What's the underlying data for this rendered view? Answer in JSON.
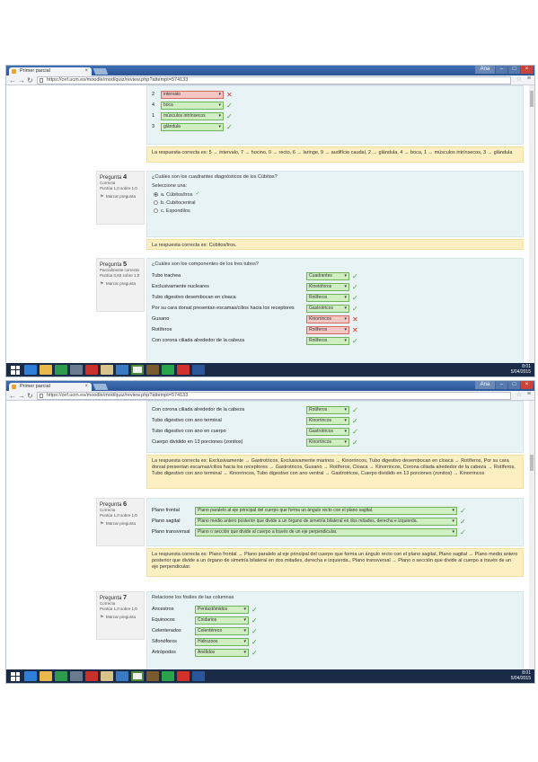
{
  "screens": [
    {
      "tab_title": "Primer parcial",
      "url": "https://cef.ucm.es/moodle/mod/quiz/review.php?attempt=574133",
      "window_user": "Ana",
      "q3_rows": [
        {
          "num": "2",
          "value": "intervalo",
          "state": "bad"
        },
        {
          "num": "4",
          "value": "boca",
          "state": "ok"
        },
        {
          "num": "1",
          "value": "músculos intrínsecos",
          "state": "ok"
        },
        {
          "num": "3",
          "value": "glándula",
          "state": "ok"
        }
      ],
      "q3_feedback": "La respuesta correcta es: 5 → intervalo, 7 → hocino, 0 → recto, 6 → laringe, 9 → audifício caudal, 2 → glándula, 4 → boca, 1 → músculos intrínsecos, 3 → glándula",
      "q4": {
        "number": "4",
        "status": "Correcta",
        "score": "Puntúa 1,0 sobre 1,0",
        "flag": "Marcar pregunta",
        "text": "¿Cuáles son los cuadrantes diagnósticos de los Cúbitos?",
        "prompt": "Seleccione una:",
        "options": [
          {
            "label": "a. Cúbitos/tros",
            "selected": true,
            "correct": true
          },
          {
            "label": "b. Cubitocentral",
            "selected": false
          },
          {
            "label": "c. Espondilos",
            "selected": false
          }
        ],
        "feedback": "La respuesta correcta es: Cúbitos/tros."
      },
      "q5": {
        "number": "5",
        "status": "Parcialmente correcta",
        "score": "Puntúa 0,60 sobre 1,0",
        "flag": "Marcar pregunta",
        "text": "¿Cuáles son los componentes de los tres tubos?",
        "rows": [
          {
            "label": "Tubo trachea",
            "value": "Cuadrantes",
            "state": "ok"
          },
          {
            "label": "Exclusivamente nucleares",
            "value": "Kinetóforos",
            "state": "ok"
          },
          {
            "label": "Tubo digestivo desembocan en cloaca",
            "value": "Rotíferos",
            "state": "ok"
          },
          {
            "label": "Por su cara dorsal presentan escamas/cilios hacia los receptores",
            "value": "Gastrotricos",
            "state": "ok"
          },
          {
            "label": "Gusano",
            "value": "Kinorrincos",
            "state": "bad"
          },
          {
            "label": "Rotíferos",
            "value": "Rotíferos",
            "state": "bad"
          },
          {
            "label": "Con corona ciliada alrededor de la cabeza",
            "value": "Rotíferos",
            "state": "ok"
          }
        ]
      }
    },
    {
      "tab_title": "Primer parcial",
      "url": "https://cef.ucm.es/moodle/mod/quiz/review.php?attempt=574133",
      "window_user": "Ana",
      "q5_rows_cont": [
        {
          "label": "Con corona ciliada alrededor de la cabeza",
          "value": "Rotíferos",
          "state": "ok"
        },
        {
          "label": "Tubo digestivo con ano terminal",
          "value": "Kinorrincos",
          "state": "ok"
        },
        {
          "label": "Tubo digestivo con ano en cuerpo",
          "value": "Gastrotricos",
          "state": "ok"
        },
        {
          "label": "Cuerpo dividido en 13 porciones (zonitos)",
          "value": "Kinorrincos",
          "state": "ok"
        }
      ],
      "q5_feedback": "La respuesta correcta es: Exclusivamente → Gastrotricos, Exclusivamente marinos → Kinorrincos, Tubo digestivo desembocan en cloaca → Rotíferos, Por su cara dorsal presentan escamas/cilios hacia los receptores → Gastrotricos, Gusano → Rotíferos, Cloaca → Kinorrincos, Corona ciliada alrededor de la cabeza → Rotíferos, Tubo digestivo con ano terminal → Kinorrincos, Tubo digestivo con ano ventral → Gastrotricos, Cuerpo dividido en 13 porciones (zonitos) → Kinorrincos",
      "q6": {
        "number": "6",
        "status": "Correcta",
        "score": "Puntúa 1,0 sobre 1,0",
        "flag": "Marcar pregunta",
        "rows": [
          {
            "label": "Plano frontal",
            "value": "Plano paralelo al eje principal del cuerpo que forma un ángulo recto con el plano sagital."
          },
          {
            "label": "Plano sagital",
            "value": "Plano medio antero posterior que divide a un órgano de simetría bilateral en dos mitades, derecha e izquierda."
          },
          {
            "label": "Plano transversal",
            "value": "Plano o sección que divide al cuerpo a través de un eje perpendicular."
          }
        ],
        "feedback": "La respuesta correcta es: Plano frontal → Plano paralelo al eje principal del cuerpo que forma un ángulo recto con el plano sagital, Plano sagital → Plano medio antero posterior que divide a un órgano de simetría bilateral en dos mitades, derecha e izquierda., Plano transversal → Plano o sección que divide al cuerpo a través de un eje perpendicular."
      },
      "q7": {
        "number": "7",
        "status": "Correcta",
        "score": "Puntúa 1,0 sobre 1,0",
        "flag": "Marcar pregunta",
        "text": "Relacione los fósiles de las columnas",
        "rows": [
          {
            "label": "Ancestros",
            "value": "Pentastómidos"
          },
          {
            "label": "Equinocos",
            "value": "Cnidarios"
          },
          {
            "label": "Celenterados",
            "value": "Celentéreos"
          },
          {
            "label": "Sifonóforos",
            "value": "Hidrozoos"
          },
          {
            "label": "Artrópodos",
            "value": "Anélidos"
          }
        ]
      }
    }
  ],
  "taskbar": {
    "tray1": "8:01\n5/04/2015",
    "tray2": "8:01\n5/04/2015"
  }
}
